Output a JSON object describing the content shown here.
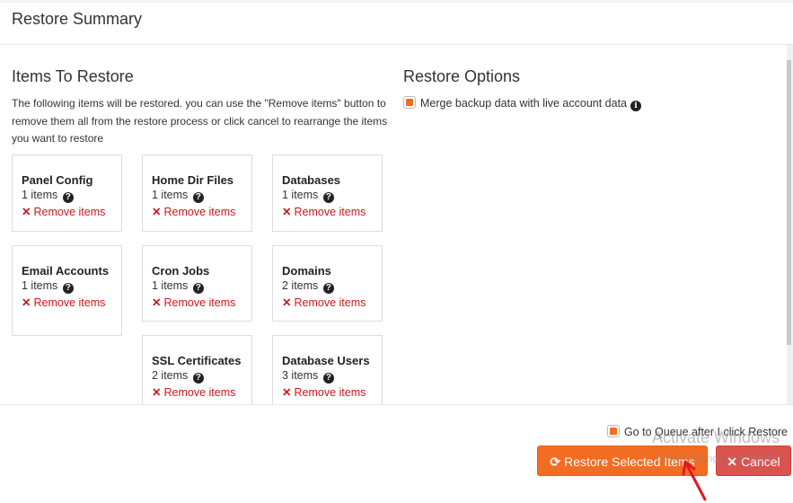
{
  "header": {
    "title": "Restore Summary"
  },
  "items_section": {
    "title": "Items To Restore",
    "description": "The following items will be restored. you can use the \"Remove items\" button to remove them all from the restore process or click cancel to rearrange the items you want to restore",
    "remove_label": "Remove items",
    "cards": [
      {
        "title": "Panel Config",
        "count": "1 items"
      },
      {
        "title": "Home Dir Files",
        "count": "1 items"
      },
      {
        "title": "Databases",
        "count": "1 items"
      },
      {
        "title": "Email Accounts",
        "count": "1 items"
      },
      {
        "title": "Cron Jobs",
        "count": "1 items"
      },
      {
        "title": "Domains",
        "count": "2 items"
      },
      {
        "title": "SSL Certificates",
        "count": "2 items"
      },
      {
        "title": "Database Users",
        "count": "3 items"
      }
    ]
  },
  "options_section": {
    "title": "Restore Options",
    "merge_label": "Merge backup data with live account data",
    "merge_checked": true
  },
  "footer": {
    "queue_label": "Go to Queue after I click Restore",
    "queue_checked": true,
    "restore_button": "Restore Selected Items",
    "cancel_button": "Cancel"
  },
  "watermark": {
    "line1": "Activate Windows",
    "line2": "Go to Settings to activate"
  },
  "colors": {
    "accent": "#f26c22",
    "danger": "#d9534f",
    "remove": "#c9181c"
  }
}
